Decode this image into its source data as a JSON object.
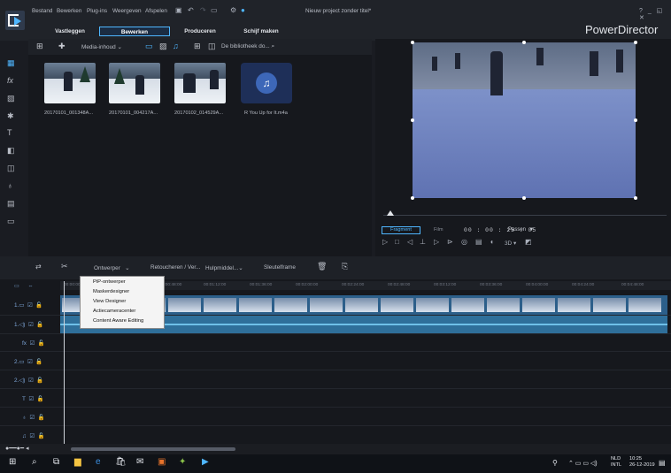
{
  "menu": {
    "items": [
      "Bestand",
      "Bewerken",
      "Plug-ins",
      "Weergeven",
      "Afspelen"
    ],
    "project_title": "Nieuw project zonder titel*",
    "window_controls": "? _ ◱ ✕",
    "brand": "PowerDirector"
  },
  "mode_tabs": [
    "Vastleggen",
    "Bewerken",
    "Produceren",
    "Schijf maken"
  ],
  "library": {
    "filter_label": "Media-inhoud",
    "search_placeholder": "De bibliotheek do...",
    "items": [
      {
        "label": "20170101_001348A..."
      },
      {
        "label": "20170101_004217A..."
      },
      {
        "label": "20170102_014529A..."
      },
      {
        "label": "R You Up for It.m4a"
      }
    ]
  },
  "preview": {
    "tab_fragment": "Fragment",
    "tab_film": "Film",
    "timecode": "00 : 00 : 25 : 05",
    "fit_label": "Passen",
    "mode_3d": "3D"
  },
  "edit_toolbar": {
    "designer_label": "Ontwerper",
    "retouch_label": "Retoucheren / Ver...",
    "tools_label": "Hulpmiddel...",
    "keyframe_label": "Sleutelframe"
  },
  "designer_menu": [
    "PiP-ontwerper",
    "Maskerdesigner",
    "View Designer",
    "Actiecameracenter",
    "Content Aware Editing"
  ],
  "ruler_times": [
    "00:00:00",
    "00:00:48:00",
    "00:01:12:00",
    "00:01:36:00",
    "00:02:00:00",
    "00:02:24:00",
    "00:02:48:00",
    "00:03:12:00",
    "00:03:36:00",
    "00:04:00:00",
    "00:04:24:00",
    "00:04:48:00"
  ],
  "tracks": [
    "1.",
    "1.",
    "fx",
    "2.",
    "2.",
    "T",
    "",
    ""
  ],
  "taskbar": {
    "lang": "NLD\nINTL",
    "time": "10:25\n26-12-2019"
  },
  "colors": {
    "accent": "#4fb6ff",
    "bg": "#1a1c22"
  }
}
